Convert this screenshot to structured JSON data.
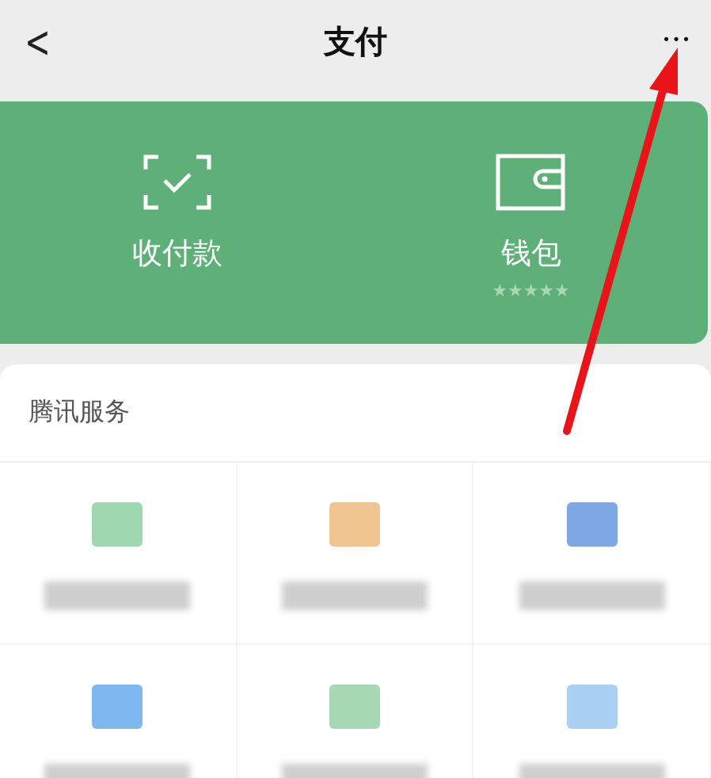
{
  "nav": {
    "back": "<",
    "title": "支付",
    "more": "•••"
  },
  "wallet_card": {
    "actions": [
      {
        "kind": "scan",
        "label": "收付款"
      },
      {
        "kind": "wallet",
        "label": "钱包",
        "masked_value": "★★★★★"
      }
    ]
  },
  "services": {
    "title": "腾讯服务",
    "tiles": [
      {
        "color": "#9fd8b0"
      },
      {
        "color": "#f0c48e"
      },
      {
        "color": "#7fa8e6"
      },
      {
        "color": "#7fb8ee"
      },
      {
        "color": "#a6d8b4"
      },
      {
        "color": "#a9cff2"
      }
    ]
  }
}
